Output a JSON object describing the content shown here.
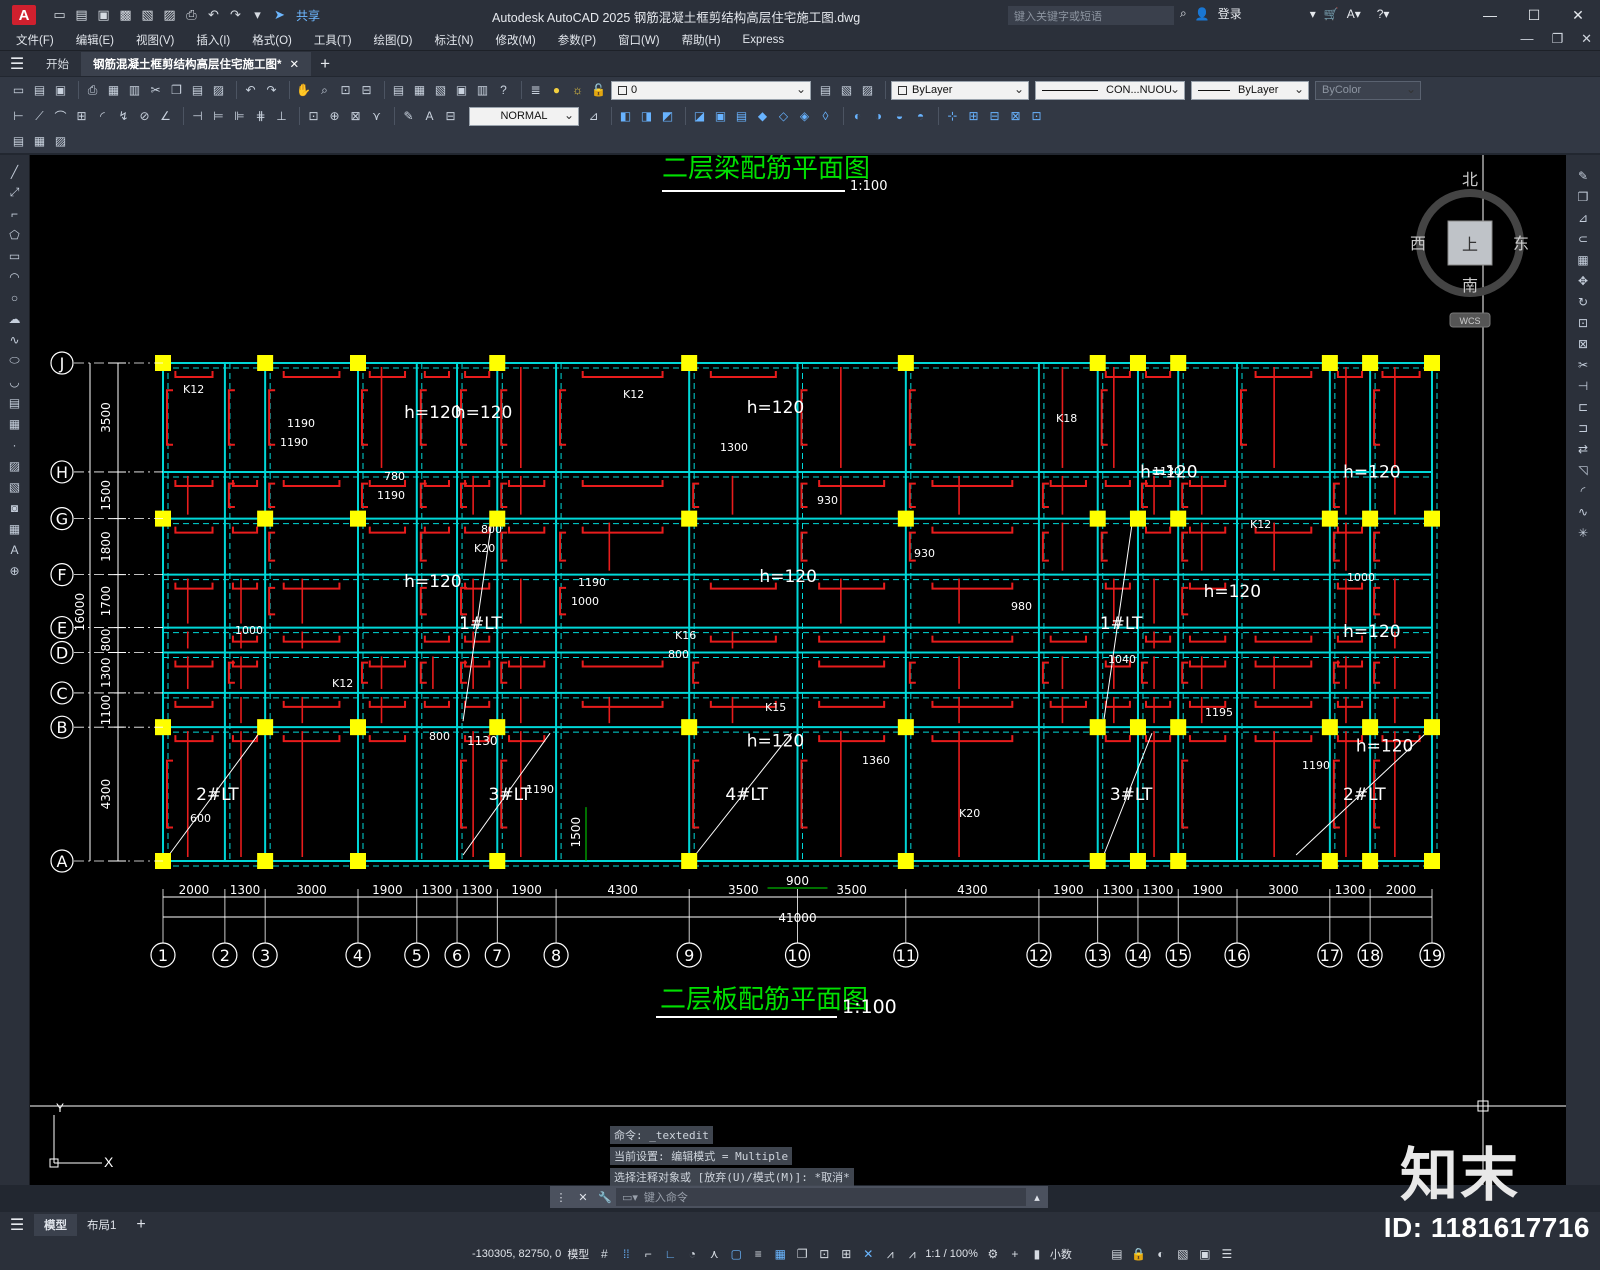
{
  "app": {
    "logo_letter": "A",
    "window_title": "Autodesk AutoCAD 2025    钢筋混凝土框剪结构高层住宅施工图.dwg",
    "search_placeholder": "键入关键字或短语",
    "login_label": "登录",
    "share_label": "共享"
  },
  "menu": [
    "文件(F)",
    "编辑(E)",
    "视图(V)",
    "插入(I)",
    "格式(O)",
    "工具(T)",
    "绘图(D)",
    "标注(N)",
    "修改(M)",
    "参数(P)",
    "窗口(W)",
    "帮助(H)",
    "Express"
  ],
  "doc_tabs": [
    {
      "label": "开始",
      "active": false
    },
    {
      "label": "钢筋混凝土框剪结构高层住宅施工图*",
      "active": true
    }
  ],
  "properties": {
    "layer": "0",
    "color": "ByLayer",
    "linetype": "CON...NUOU",
    "lineweight": "ByLayer",
    "plotstyle": "ByColor",
    "text_style": "NORMAL"
  },
  "drawing": {
    "title_top": "二层梁配筋平面图",
    "scale_top": "1:100",
    "title_bottom": "二层板配筋平面图",
    "scale_bottom": "1:100",
    "row_axes": [
      "J",
      "H",
      "G",
      "F",
      "E",
      "D",
      "C",
      "B",
      "A"
    ],
    "row_dims": [
      "3500",
      "1500",
      "1800",
      "1700",
      "800",
      "1300",
      "1100",
      "4300"
    ],
    "total_row_dim": "16000",
    "col_axes": [
      "1",
      "2",
      "3",
      "4",
      "5",
      "6",
      "7",
      "8",
      "9",
      "10",
      "11",
      "12",
      "13",
      "14",
      "15",
      "16",
      "17",
      "18",
      "19"
    ],
    "col_dims": [
      "2000",
      "1300",
      "3000",
      "1900",
      "1300",
      "1300",
      "1900",
      "4300",
      "3500",
      "3500",
      "4300",
      "1900",
      "1300",
      "1300",
      "1900",
      "3000",
      "1300",
      "2000"
    ],
    "total_col_dim": "41000",
    "extra_dims": [
      "900",
      "1500",
      "1130"
    ],
    "slab_labels": [
      "h=120",
      "h=120",
      "h=120",
      "h=120",
      "h=120",
      "h=120",
      "h=120",
      "h=120",
      "h=120",
      "h=120",
      "h=120"
    ],
    "stair_labels": [
      "1#LT",
      "1#LT",
      "2#LT",
      "2#LT",
      "3#LT",
      "3#LT",
      "4#LT"
    ],
    "rebar_texts": [
      "K12",
      "1190",
      "1190",
      "K20",
      "1000",
      "800",
      "K15",
      "1360",
      "K20",
      "K18",
      "1130",
      "K12",
      "1000",
      "1000",
      "K12",
      "800",
      "1190",
      "K12",
      "1300",
      "930",
      "930",
      "980",
      "1040",
      "1195",
      "1190",
      "600",
      "1190",
      "780",
      "800",
      "1190",
      "K16"
    ]
  },
  "viewcube": {
    "north": "北",
    "south": "南",
    "west": "西",
    "east": "东",
    "face": "上",
    "wcs": "WCS"
  },
  "command": {
    "history": [
      "命令: _textedit",
      "当前设置: 编辑模式 = Multiple",
      "选择注释对象或 [放弃(U)/模式(M)]: *取消*"
    ],
    "placeholder": "键入命令"
  },
  "layouts": [
    {
      "label": "模型",
      "active": true
    },
    {
      "label": "布局1",
      "active": false
    }
  ],
  "status": {
    "coords": "-130305, 82750, 0",
    "model_label": "模型",
    "scale": "1:1 / 100%",
    "units": "小数"
  },
  "watermark": {
    "logo": "知末",
    "id": "ID: 1181617716"
  },
  "colors": {
    "background": "#000000",
    "beam": "#00d8d8",
    "rebar": "#e81c1c",
    "column": "#ffff00",
    "title": "#00e000",
    "dims": "#ffffff",
    "accent": "#6ab6ff"
  }
}
